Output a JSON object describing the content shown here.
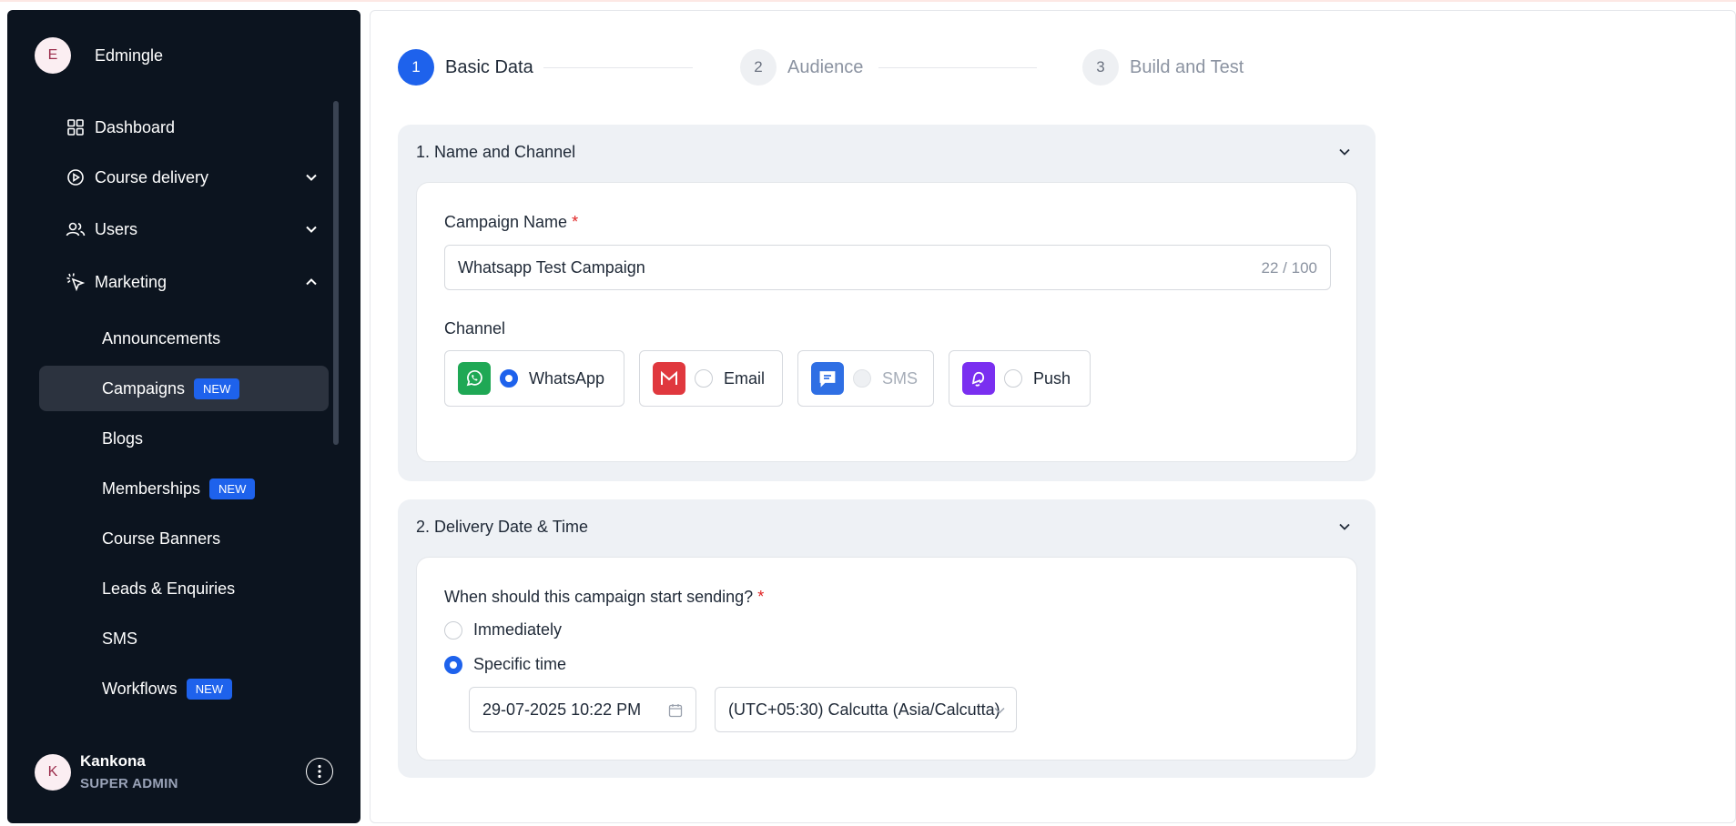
{
  "sidebar": {
    "brand": {
      "avatar_initial": "E",
      "name": "Edmingle"
    },
    "nav": [
      {
        "label": "Dashboard"
      },
      {
        "label": "Course delivery"
      },
      {
        "label": "Users"
      },
      {
        "label": "Marketing"
      }
    ],
    "marketing_items": [
      {
        "label": "Announcements",
        "badge": ""
      },
      {
        "label": "Campaigns",
        "badge": "NEW"
      },
      {
        "label": "Blogs",
        "badge": ""
      },
      {
        "label": "Memberships",
        "badge": "NEW"
      },
      {
        "label": "Course Banners",
        "badge": ""
      },
      {
        "label": "Leads & Enquiries",
        "badge": ""
      },
      {
        "label": "SMS",
        "badge": ""
      },
      {
        "label": "Workflows",
        "badge": "NEW"
      }
    ],
    "profile": {
      "avatar_initial": "K",
      "name": "Kankona",
      "role": "SUPER ADMIN"
    }
  },
  "stepper": {
    "steps": [
      {
        "number": "1",
        "label": "Basic Data"
      },
      {
        "number": "2",
        "label": "Audience"
      },
      {
        "number": "3",
        "label": "Build and Test"
      }
    ]
  },
  "section1": {
    "title": "1. Name and Channel",
    "campaign_name_label": "Campaign Name",
    "required_mark": "*",
    "campaign_name_value": "Whatsapp Test Campaign",
    "counter": "22 / 100",
    "channel_label": "Channel",
    "channels": [
      {
        "label": "WhatsApp",
        "selected": true
      },
      {
        "label": "Email",
        "selected": false
      },
      {
        "label": "SMS",
        "selected": false,
        "disabled": true
      },
      {
        "label": "Push",
        "selected": false
      }
    ]
  },
  "section2": {
    "title": "2. Delivery Date & Time",
    "question": "When should this campaign start sending?",
    "required_mark": "*",
    "options": [
      {
        "label": "Immediately",
        "selected": false
      },
      {
        "label": "Specific time",
        "selected": true
      }
    ],
    "datetime_value": "29-07-2025 10:22 PM",
    "timezone_value": "(UTC+05:30) Calcutta (Asia/Calcutta)"
  },
  "colors": {
    "accent": "#1e62ec",
    "sidebar_bg": "#0c141f",
    "whatsapp": "#1fa855",
    "email": "#e0383e",
    "sms": "#2f6fe4",
    "push": "#7a2ff0"
  }
}
